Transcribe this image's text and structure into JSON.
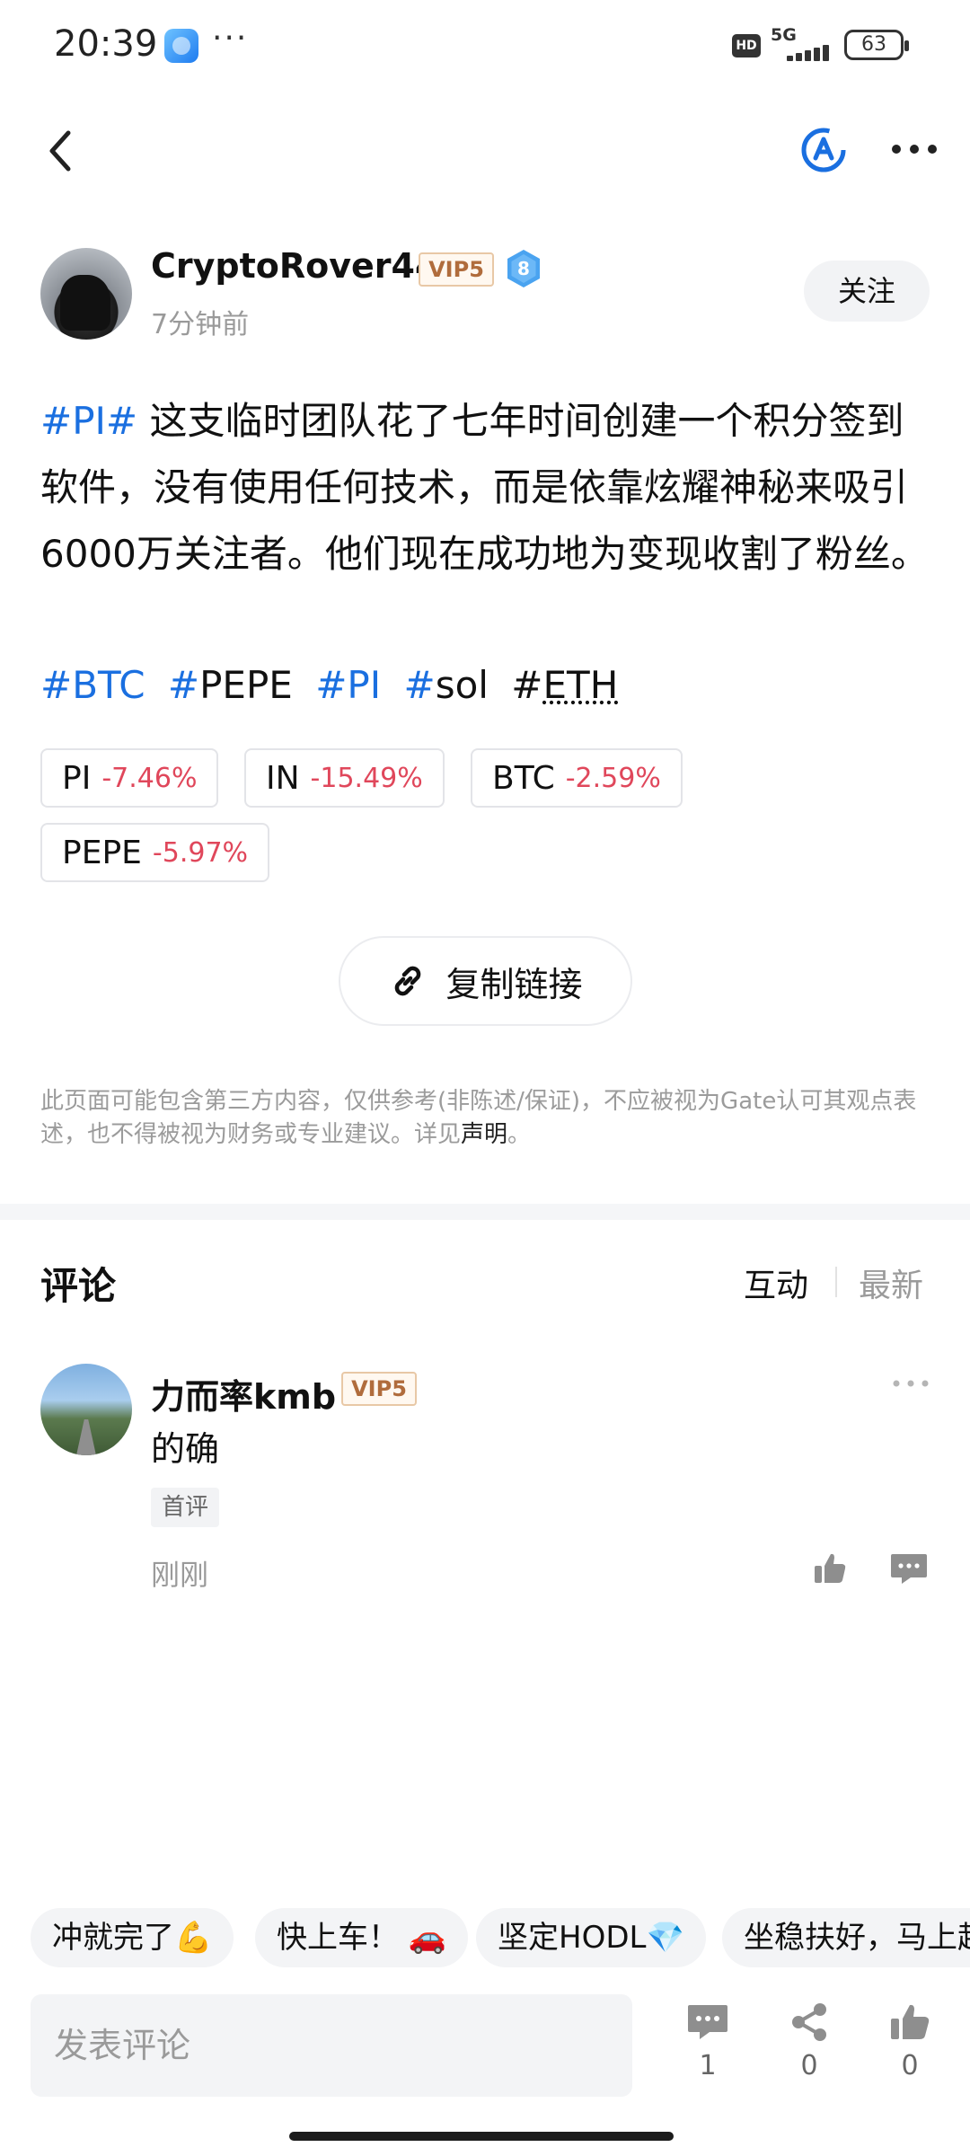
{
  "status_bar": {
    "time": "20:39",
    "network": "5G",
    "hd": "HD",
    "battery": "63"
  },
  "author": {
    "name": "CryptoRover44",
    "vip": "VIP5",
    "level": "8",
    "time_ago": "7分钟前",
    "follow_label": "关注"
  },
  "post": {
    "topic_tag": "#PI#",
    "body": " 这支临时团队花了七年时间创建一个积分签到软件，没有使用任何技术，而是依靠炫耀神秘来吸引6000万关注者。他们现在成功地为变现收割了粉丝。",
    "hashtags": [
      {
        "hash": "#",
        "label": "BTC"
      },
      {
        "hash": "#",
        "label": "PEPE"
      },
      {
        "hash": "#",
        "label": "PI"
      },
      {
        "hash": "#",
        "label": "sol"
      },
      {
        "hash": "#",
        "label": "ETH"
      }
    ]
  },
  "coins": [
    {
      "symbol": "PI",
      "change": "-7.46%"
    },
    {
      "symbol": "IN",
      "change": "-15.49%"
    },
    {
      "symbol": "BTC",
      "change": "-2.59%"
    },
    {
      "symbol": "PEPE",
      "change": "-5.97%"
    }
  ],
  "copy_link_label": "复制链接",
  "disclaimer": {
    "text": "此页面可能包含第三方内容，仅供参考(非陈述/保证)，不应被视为Gate认可其观点表述，也不得被视为财务或专业建议。详见",
    "link": "声明",
    "end": "。"
  },
  "comments": {
    "title": "评论",
    "tab_interact": "互动",
    "tab_latest": "最新",
    "items": [
      {
        "name": "力而率kmb",
        "vip": "VIP5",
        "text": "的确",
        "badge": "首评",
        "time": "刚刚"
      }
    ]
  },
  "quick_replies": [
    "冲就完了💪",
    "快上车！ 🚗",
    "坚定HODL💎",
    "坐稳扶好，马上起飞"
  ],
  "bottom_bar": {
    "input_placeholder": "发表评论",
    "comment_count": "1",
    "share_count": "0",
    "like_count": "0"
  },
  "colors": {
    "hashtag_blue": "#1a6fe0",
    "negative_red": "#e0475b",
    "vip_brown": "#b06c3c"
  }
}
